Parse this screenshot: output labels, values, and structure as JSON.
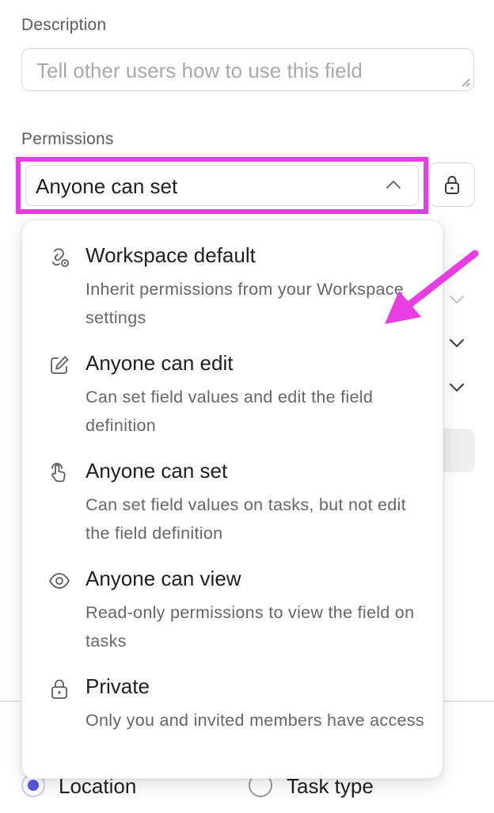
{
  "description": {
    "label": "Description",
    "placeholder": "Tell other users how to use this field"
  },
  "permissions": {
    "label": "Permissions",
    "selected": "Anyone can set",
    "highlight_color": "#e83de0",
    "options": [
      {
        "icon": "workspace-icon",
        "title": "Workspace default",
        "desc": "Inherit permissions from your Workspace settings"
      },
      {
        "icon": "edit-icon",
        "title": "Anyone can edit",
        "desc": "Can set field values and edit the field definition"
      },
      {
        "icon": "set-hand-icon",
        "title": "Anyone can set",
        "desc": "Can set field values on tasks, but not edit the field definition"
      },
      {
        "icon": "eye-icon",
        "title": "Anyone can view",
        "desc": "Read-only permissions to view the field on tasks"
      },
      {
        "icon": "lock-icon",
        "title": "Private",
        "desc": "Only you and invited members have access"
      }
    ]
  },
  "footer": {
    "radios": [
      {
        "label": "Location",
        "checked": true
      },
      {
        "label": "Task type",
        "checked": false
      }
    ]
  },
  "colors": {
    "accent": "#5b55e6",
    "annotation": "#e83de0"
  }
}
